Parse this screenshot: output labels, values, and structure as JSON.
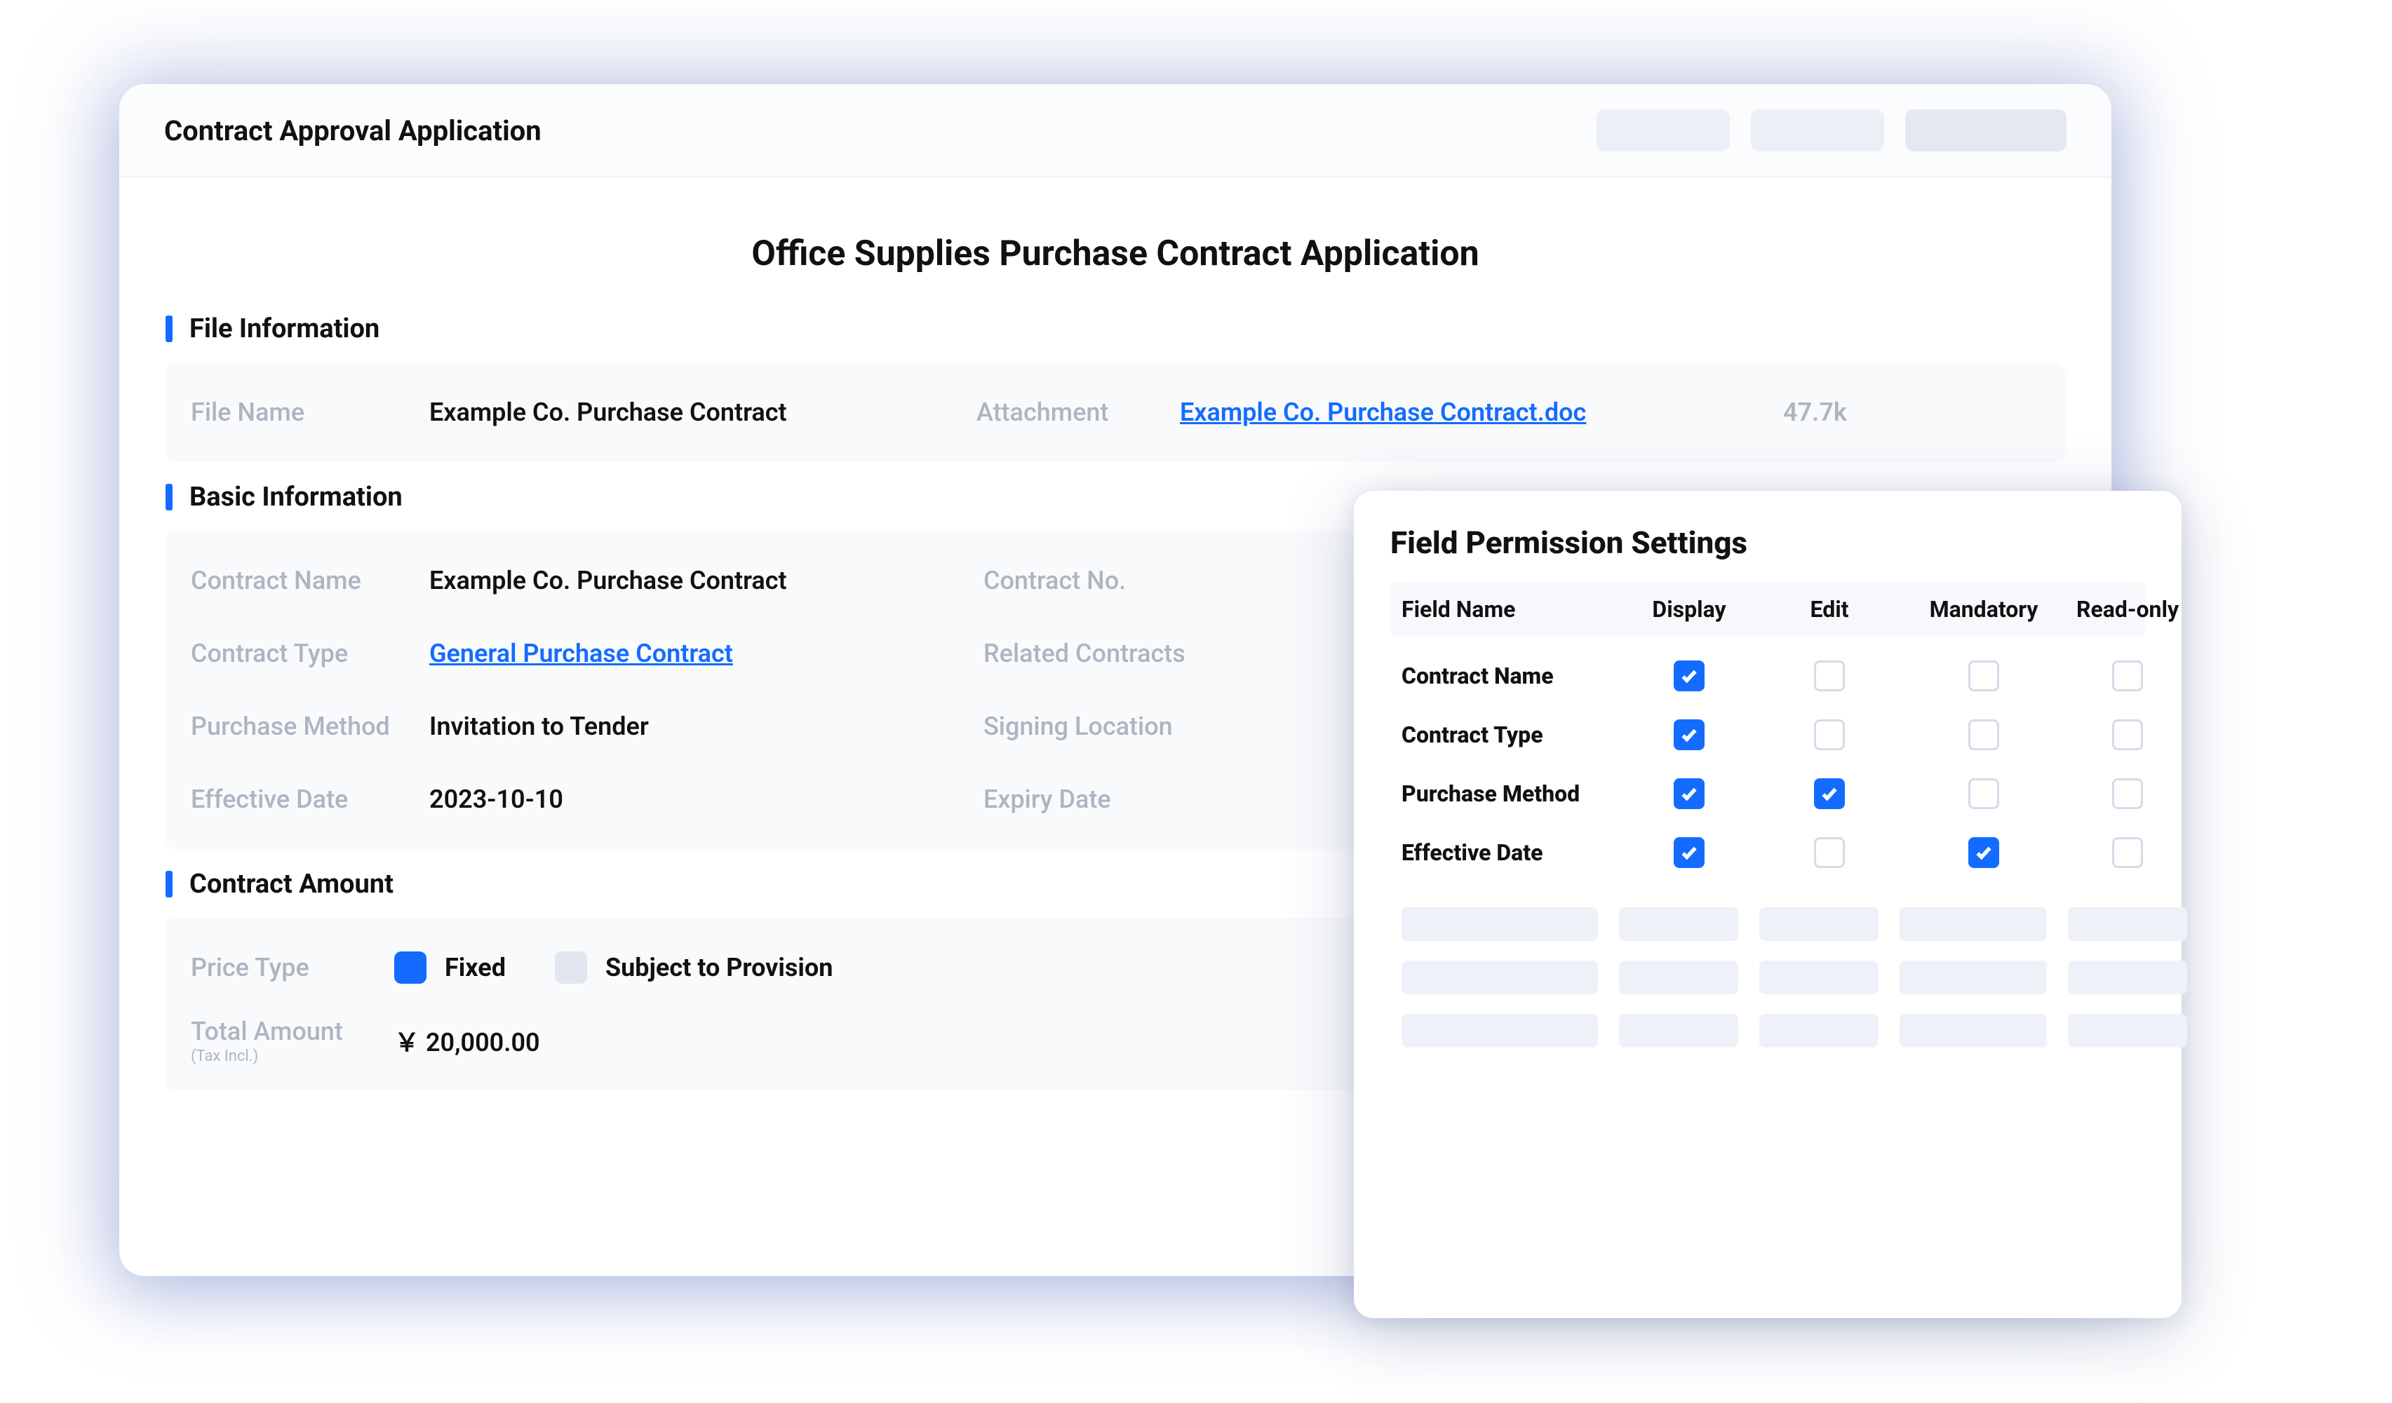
{
  "header": {
    "title": "Contract Approval Application"
  },
  "form": {
    "title": "Office Supplies Purchase Contract Application"
  },
  "sections": {
    "file": {
      "title": "File Information",
      "filename_label": "File Name",
      "filename": "Example Co. Purchase Contract",
      "attachment_label": "Attachment",
      "attachment_name": "Example Co. Purchase Contract.doc",
      "attachment_size": "47.7k"
    },
    "basic": {
      "title": "Basic Information",
      "contract_name_label": "Contract Name",
      "contract_name": "Example Co. Purchase Contract",
      "contract_no_label": "Contract No.",
      "contract_type_label": "Contract Type",
      "contract_type": "General Purchase Contract",
      "related_contracts_label": "Related Contracts",
      "purchase_method_label": "Purchase Method",
      "purchase_method": "Invitation to Tender",
      "signing_location_label": "Signing Location",
      "effective_date_label": "Effective Date",
      "effective_date": "2023-10-10",
      "expiry_date_label": "Expiry Date"
    },
    "amount": {
      "title": "Contract Amount",
      "price_type_label": "Price Type",
      "option_fixed": "Fixed",
      "option_provision": "Subject to Provision",
      "total_amount_label": "Total Amount",
      "total_amount_sub": "(Tax Incl.)",
      "total_amount": "￥ 20,000.00"
    }
  },
  "permissions": {
    "title": "Field Permission Settings",
    "columns": {
      "field_name": "Field Name",
      "display": "Display",
      "edit": "Edit",
      "mandatory": "Mandatory",
      "readonly": "Read-only"
    },
    "rows": [
      {
        "name": "Contract Name",
        "display": true,
        "edit": false,
        "mandatory": false,
        "readonly": false
      },
      {
        "name": "Contract Type",
        "display": true,
        "edit": false,
        "mandatory": false,
        "readonly": false
      },
      {
        "name": "Purchase Method",
        "display": true,
        "edit": true,
        "mandatory": false,
        "readonly": false
      },
      {
        "name": "Effective Date",
        "display": true,
        "edit": false,
        "mandatory": true,
        "readonly": false
      }
    ]
  }
}
